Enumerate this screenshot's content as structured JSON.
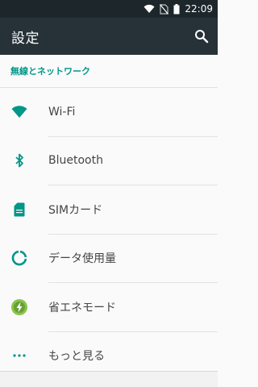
{
  "status_bar": {
    "time": "22:09",
    "icons": [
      "wifi-icon",
      "no-sim-icon",
      "battery-icon"
    ]
  },
  "app_bar": {
    "title": "設定",
    "search_icon": "search-icon"
  },
  "section": {
    "header": "無線とネットワーク",
    "items": [
      {
        "label": "Wi-Fi",
        "icon": "wifi-icon"
      },
      {
        "label": "Bluetooth",
        "icon": "bluetooth-icon"
      },
      {
        "label": "SIMカード",
        "icon": "sim-card-icon"
      },
      {
        "label": "データ使用量",
        "icon": "data-usage-icon"
      },
      {
        "label": "省エネモード",
        "icon": "battery-saver-icon"
      },
      {
        "label": "もっと見る",
        "icon": "more-icon"
      }
    ]
  },
  "colors": {
    "accent": "#009688",
    "app_bar": "#263238",
    "status_bar": "#1d272b",
    "background": "#fafafa"
  }
}
